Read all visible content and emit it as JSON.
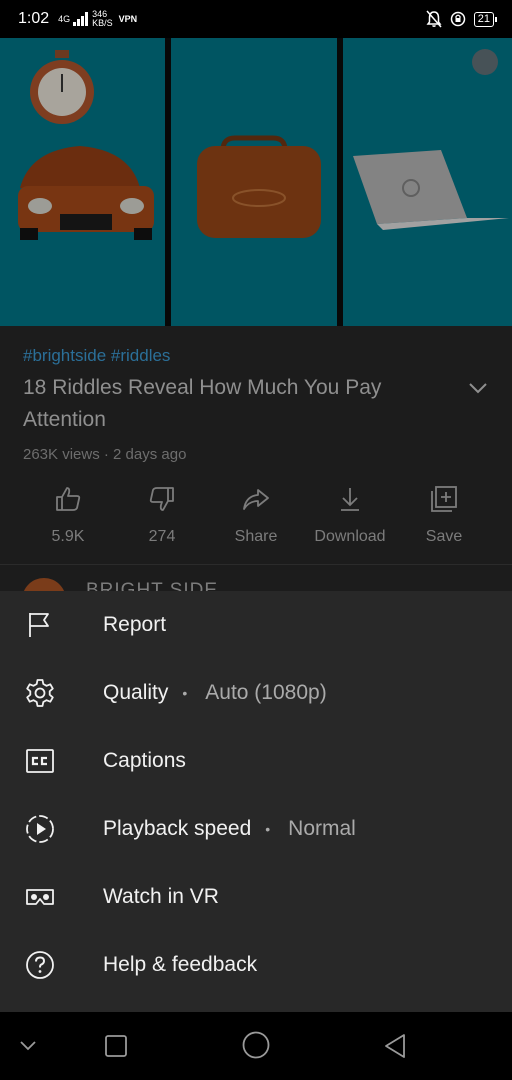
{
  "status_bar": {
    "time": "1:02",
    "network_top": "4G",
    "speed_value": "346",
    "speed_unit": "KB/S",
    "vpn": "VPN",
    "battery": "21"
  },
  "video": {
    "hashtags": "#brightside #riddles",
    "title": "18 Riddles Reveal How Much You Pay Attention",
    "meta": "263K views · 2 days ago"
  },
  "actions": [
    {
      "label": "5.9K",
      "icon": "thumbs-up-icon"
    },
    {
      "label": "274",
      "icon": "thumbs-down-icon"
    },
    {
      "label": "Share",
      "icon": "share-icon"
    },
    {
      "label": "Download",
      "icon": "download-icon"
    },
    {
      "label": "Save",
      "icon": "save-to-playlist-icon"
    }
  ],
  "channel": {
    "name": "BRIGHT SIDE"
  },
  "menu": [
    {
      "label": "Report",
      "icon": "flag-icon"
    },
    {
      "label": "Quality",
      "icon": "gear-icon",
      "value": "Auto (1080p)"
    },
    {
      "label": "Captions",
      "icon": "closed-captions-icon"
    },
    {
      "label": "Playback speed",
      "icon": "playback-speed-icon",
      "value": "Normal"
    },
    {
      "label": "Watch in VR",
      "icon": "vr-headset-icon"
    },
    {
      "label": "Help & feedback",
      "icon": "help-icon"
    }
  ],
  "nav_bar": [
    "back-chevron-icon",
    "recents-square-icon",
    "home-circle-icon",
    "back-triangle-icon"
  ],
  "colors": {
    "sheet_background": "#282828",
    "hashtag": "#2b6f98",
    "video_panel": "#006d7e"
  }
}
